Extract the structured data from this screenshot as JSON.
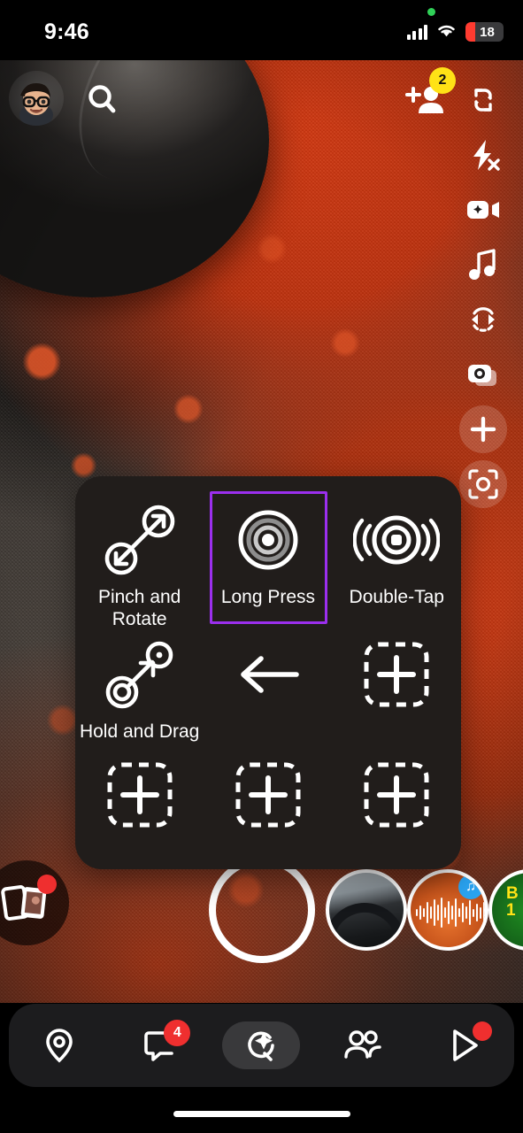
{
  "status_bar": {
    "time": "9:46",
    "battery_percent": "18",
    "recording_indicator": "green-dot",
    "signal_icon": "cellular-signal-icon",
    "wifi_icon": "wifi-icon",
    "battery_low_color": "#ff3b30"
  },
  "top_controls": {
    "avatar": "bitmoji-avatar",
    "search_icon": "search-icon",
    "add_friend_icon": "add-friend-icon",
    "add_friend_badge": "2",
    "badge_color": "#ffe216"
  },
  "toolbar": {
    "items": [
      {
        "icon": "camera-flip-icon",
        "name": "flip-camera"
      },
      {
        "icon": "flash-off-icon",
        "name": "flash-off"
      },
      {
        "icon": "night-video-icon",
        "name": "night-mode"
      },
      {
        "icon": "music-note-icon",
        "name": "music"
      },
      {
        "icon": "rotate-arrows-icon",
        "name": "lens-rotate"
      },
      {
        "icon": "multi-snap-icon",
        "name": "multi-snap"
      },
      {
        "icon": "plus-icon",
        "name": "add-to-story"
      },
      {
        "icon": "scan-icon",
        "name": "scan"
      }
    ]
  },
  "gesture_panel": {
    "accent_color": "#9b2fee",
    "background_color": "#211d1b",
    "rows": [
      [
        {
          "label": "Pinch and Rotate",
          "icon": "pinch-rotate-icon",
          "selected": false,
          "empty": false
        },
        {
          "label": "Long Press",
          "icon": "long-press-icon",
          "selected": true,
          "empty": false
        },
        {
          "label": "Double-Tap",
          "icon": "double-tap-icon",
          "selected": false,
          "empty": false
        }
      ],
      [
        {
          "label": "Hold and Drag",
          "icon": "hold-drag-icon",
          "selected": false,
          "empty": false
        },
        {
          "label": "",
          "icon": "back-arrow-icon",
          "selected": false,
          "empty": false
        },
        {
          "label": "",
          "icon": "add-placeholder-icon",
          "selected": false,
          "empty": true
        }
      ],
      [
        {
          "label": "",
          "icon": "add-placeholder-icon",
          "selected": false,
          "empty": true
        },
        {
          "label": "",
          "icon": "add-placeholder-icon",
          "selected": false,
          "empty": true
        },
        {
          "label": "",
          "icon": "add-placeholder-icon",
          "selected": false,
          "empty": true
        }
      ]
    ]
  },
  "camera_bar": {
    "memories_icon": "memories-icon",
    "memories_has_badge": true,
    "shutter": "shutter-button",
    "lenses": [
      {
        "name": "lens-driving",
        "label": ""
      },
      {
        "name": "lens-sound-wave",
        "label": "",
        "badge_icon": "music-badge-icon"
      },
      {
        "name": "lens-green",
        "label": "B\n1"
      }
    ]
  },
  "nav_bar": {
    "items": [
      {
        "name": "map",
        "icon": "map-pin-icon",
        "badge": "",
        "dot": false,
        "active": false
      },
      {
        "name": "chat",
        "icon": "chat-bubble-icon",
        "badge": "4",
        "dot": false,
        "active": false
      },
      {
        "name": "camera",
        "icon": "camera-star-icon",
        "badge": "",
        "dot": false,
        "active": true
      },
      {
        "name": "friends",
        "icon": "friends-icon",
        "badge": "",
        "dot": false,
        "active": false
      },
      {
        "name": "spotlight",
        "icon": "play-triangle-icon",
        "badge": "",
        "dot": true,
        "active": false
      }
    ],
    "badge_color": "#ef2f2f"
  }
}
